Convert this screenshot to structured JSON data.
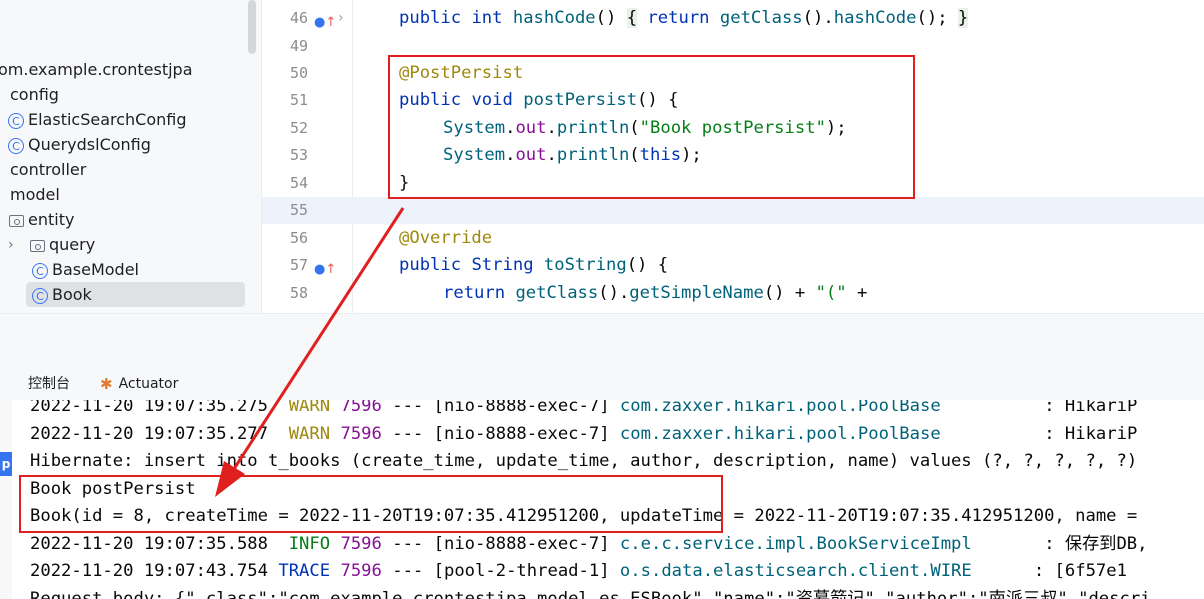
{
  "project_tree": {
    "items": [
      {
        "label": "om.example.crontestjpa",
        "kind": "package"
      },
      {
        "label": "config",
        "kind": "folder"
      },
      {
        "label": "ElasticSearchConfig",
        "kind": "class"
      },
      {
        "label": "QuerydslConfig",
        "kind": "class"
      },
      {
        "label": "controller",
        "kind": "folder"
      },
      {
        "label": "model",
        "kind": "folder"
      },
      {
        "label": "entity",
        "kind": "package"
      },
      {
        "label": "query",
        "kind": "package"
      },
      {
        "label": "BaseModel",
        "kind": "class"
      },
      {
        "label": "Book",
        "kind": "class",
        "selected": true
      }
    ]
  },
  "editor": {
    "line_numbers": [
      "46",
      "49",
      "50",
      "51",
      "52",
      "53",
      "54",
      "55",
      "56",
      "57",
      "58"
    ],
    "line46": {
      "kw1": "public",
      "kw2": "int",
      "fn": "hashCode",
      "p1": "() ",
      "b1": "{",
      "sp": " ",
      "kw3": "return",
      "fn2": "getClass",
      "p2": "().",
      "fn3": "hashCode",
      "p3": "(); ",
      "b2": "}"
    },
    "line50": {
      "annotation": "@PostPersist"
    },
    "line51": {
      "kw1": "public",
      "kw2": "void",
      "fn": "postPersist",
      "rest": "() {"
    },
    "line52": {
      "cls": "System",
      "dot": ".",
      "field": "out",
      "dot2": ".",
      "fn": "println",
      "p1": "(",
      "str": "\"Book postPersist\"",
      "p2": ");"
    },
    "line53": {
      "cls": "System",
      "dot": ".",
      "field": "out",
      "dot2": ".",
      "fn": "println",
      "p1": "(",
      "kw": "this",
      "p2": ");"
    },
    "line54": {
      "brace": "}"
    },
    "line56": {
      "annotation": "@Override"
    },
    "line57": {
      "kw1": "public",
      "type": "String",
      "fn": "toString",
      "rest": "() {"
    },
    "line58": {
      "kw": "return",
      "fn": "getClass",
      "p1": "().",
      "fn2": "getSimpleName",
      "p2": "() + ",
      "str": "\"(\"",
      "p3": " +"
    }
  },
  "tool_window": {
    "tabs": [
      {
        "label": "控制台"
      },
      {
        "label": "Actuator"
      }
    ],
    "side_badge": "p"
  },
  "console": {
    "lines": [
      {
        "ts": "2022-11-20 19:07:35.275",
        "level": "WARN",
        "pid": "7596",
        "sep": "---",
        "thread": "[nio-8888-exec-7]",
        "logger": "com.zaxxer.hikari.pool.PoolBase",
        "msg": ": HikariP"
      },
      {
        "ts": "2022-11-20 19:07:35.277",
        "level": "WARN",
        "pid": "7596",
        "sep": "---",
        "thread": "[nio-8888-exec-7]",
        "logger": "com.zaxxer.hikari.pool.PoolBase",
        "msg": ": HikariP"
      },
      {
        "plain": "Hibernate: insert into t_books (create_time, update_time, author, description, name) values (?, ?, ?, ?, ?)"
      },
      {
        "plain": "Book postPersist"
      },
      {
        "plain": "Book(id = 8, createTime = 2022-11-20T19:07:35.412951200, updateTime = 2022-11-20T19:07:35.412951200, name ="
      },
      {
        "ts": "2022-11-20 19:07:35.588",
        "level": "INFO",
        "pid": "7596",
        "sep": "---",
        "thread": "[nio-8888-exec-7]",
        "logger": "c.e.c.service.impl.BookServiceImpl",
        "msg": ": 保存到DB,"
      },
      {
        "ts": "2022-11-20 19:07:43.754",
        "level": "TRACE",
        "pid": "7596",
        "sep": "---",
        "thread": "[pool-2-thread-1]",
        "logger": "o.s.data.elasticsearch.client.WIRE",
        "msg": ": [6f57e1"
      },
      {
        "plain": "Request body: {\"_class\":\"com.example.crontestjpa.model.es.ESBook\",\"name\":\"资暮箭记\",\"author\":\"南派三叔\",\"descri"
      }
    ]
  },
  "colors": {
    "annotation_box": "#e0201e",
    "arrow": "#e0201e",
    "keyword": "#0033b3",
    "string": "#067d17"
  }
}
